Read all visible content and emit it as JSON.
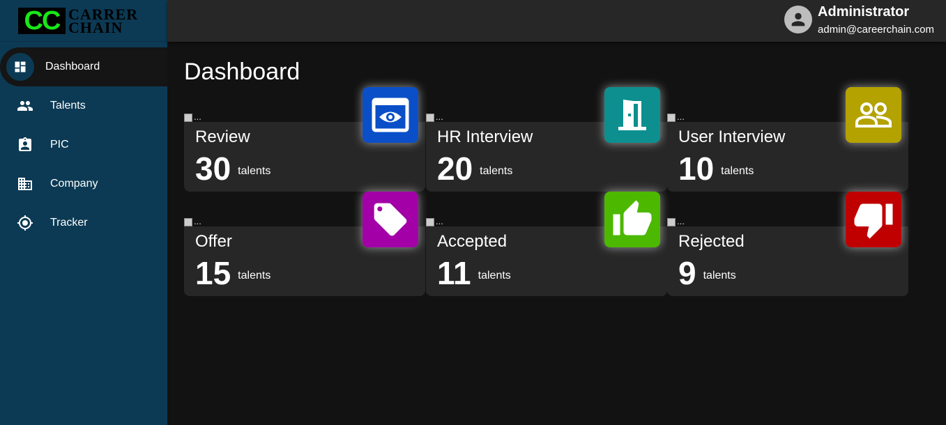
{
  "brand": {
    "mark": "CC",
    "line1": "CARRER",
    "line2": "CHAIN"
  },
  "nav": [
    {
      "label": "Dashboard",
      "icon": "dashboard-icon",
      "active": true
    },
    {
      "label": "Talents",
      "icon": "people-icon"
    },
    {
      "label": "PIC",
      "icon": "badge-icon"
    },
    {
      "label": "Company",
      "icon": "company-icon"
    },
    {
      "label": "Tracker",
      "icon": "crosshair-icon"
    }
  ],
  "user": {
    "name": "Administrator",
    "email": "admin@careerchain.com"
  },
  "page": {
    "title": "Dashboard"
  },
  "cards": [
    {
      "title": "Review",
      "count": "30",
      "unit": "talents",
      "icon": "eye-icon",
      "color": "#0a4fc8",
      "img_alt": "..."
    },
    {
      "title": "HR Interview",
      "count": "20",
      "unit": "talents",
      "icon": "door-icon",
      "color": "#0d8f8f",
      "img_alt": "..."
    },
    {
      "title": "User Interview",
      "count": "10",
      "unit": "talents",
      "icon": "group-icon",
      "color": "#b3a200",
      "img_alt": "..."
    },
    {
      "title": "Offer",
      "count": "15",
      "unit": "talents",
      "icon": "tag-icon",
      "color": "#a300a8",
      "img_alt": "..."
    },
    {
      "title": "Accepted",
      "count": "11",
      "unit": "talents",
      "icon": "thumbs-up-icon",
      "color": "#4cb800",
      "img_alt": "..."
    },
    {
      "title": "Rejected",
      "count": "9",
      "unit": "talents",
      "icon": "thumbs-down-icon",
      "color": "#c00000",
      "img_alt": "..."
    }
  ]
}
